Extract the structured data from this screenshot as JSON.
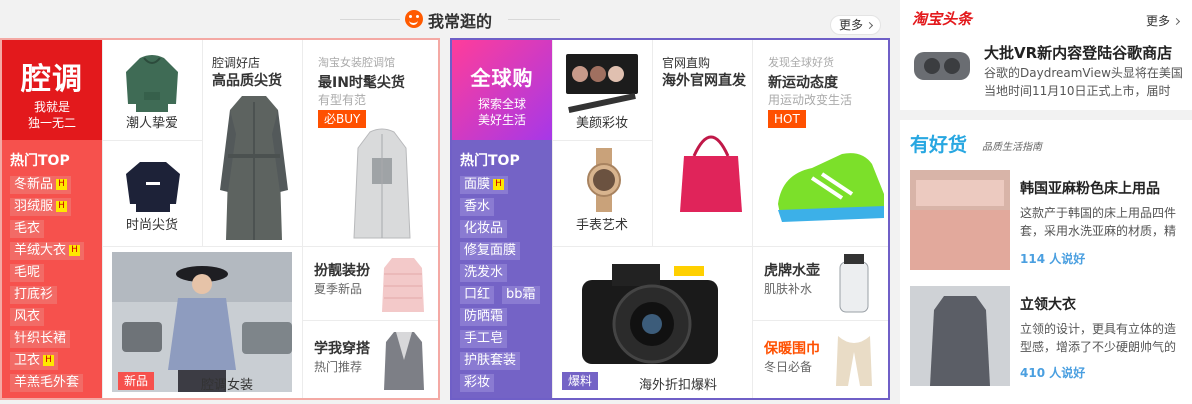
{
  "header": {
    "title": "我常逛的",
    "more": "更多"
  },
  "panel1": {
    "brand": {
      "name": "腔调",
      "line1": "我就是",
      "line2": "独一无二"
    },
    "hot_label": "热门TOP",
    "tags": [
      "冬新品",
      "羽绒服",
      "毛衣",
      "羊绒大衣",
      "毛呢",
      "打底衫",
      "风衣",
      "针织长裙",
      "卫衣",
      "羊羔毛外套"
    ],
    "hot_tags": [
      0,
      1,
      3,
      8
    ],
    "items": {
      "hoodie": "潮人挚爱",
      "sweat": "时尚尖货",
      "coat_store": "腔调好店",
      "coat_title": "高品质尖货",
      "promo_top": "淘宝女装腔调馆",
      "promo_title": "最IN时髦尖货",
      "promo_sub": "有型有范",
      "promo_badge": "必BUY",
      "new_badge": "新品",
      "feature_caption": "腔调女装",
      "ladylike_title": "扮靓装扮",
      "ladylike_sub": "夏季新品",
      "learn_title": "学我穿搭",
      "learn_sub": "热门推荐"
    }
  },
  "panel2": {
    "brand": {
      "name": "全球购",
      "line1": "探索全球",
      "line2": "美好生活"
    },
    "hot_label": "热门TOP",
    "tags": [
      [
        "面膜"
      ],
      [
        "香水"
      ],
      [
        "化妆品"
      ],
      [
        "修复面膜"
      ],
      [
        "洗发水"
      ],
      [
        "口红",
        "bb霜"
      ],
      [
        "防晒霜"
      ],
      [
        "手工皂"
      ],
      [
        "护肤套装"
      ],
      [
        "彩妆"
      ]
    ],
    "hot_tags": [
      0
    ],
    "items": {
      "makeup": "美颜彩妆",
      "watch": "手表艺术",
      "direct_store": "官网直购",
      "direct_title": "海外官网直发",
      "sport_top": "发现全球好货",
      "sport_title": "新运动态度",
      "sport_sub": "用运动改变生活",
      "sport_badge": "HOT",
      "burst_badge": "爆料",
      "camera_caption": "海外折扣爆料",
      "kettle_title": "虎牌水壶",
      "kettle_sub": "肌肤补水",
      "scarf_title": "保暖围巾",
      "scarf_sub": "冬日必备"
    }
  },
  "right": {
    "top_logo": "淘宝头条",
    "top_more": "更多",
    "news_title": "大批VR新内容登陆谷歌商店",
    "news_text": "谷歌的DaydreamView头显将在美国当地时间11月10日正式上市，届时",
    "section_logo": "有好货",
    "section_slogan": "品质生活指南",
    "items": [
      {
        "title": "韩国亚麻粉色床上用品",
        "text": "这款产于韩国的床上用品四件套，采用水洗亚麻的材质，精",
        "likes": "114 人说好"
      },
      {
        "title": "立领大衣",
        "text": "立领的设计，更具有立体的造型感，增添了不少硬朗帅气的",
        "likes": "410 人说好"
      }
    ]
  },
  "colors": {
    "red": "#e8262a",
    "pink_tag": "#f26b66",
    "purple": "#7463c6",
    "orange": "#ff5000"
  }
}
